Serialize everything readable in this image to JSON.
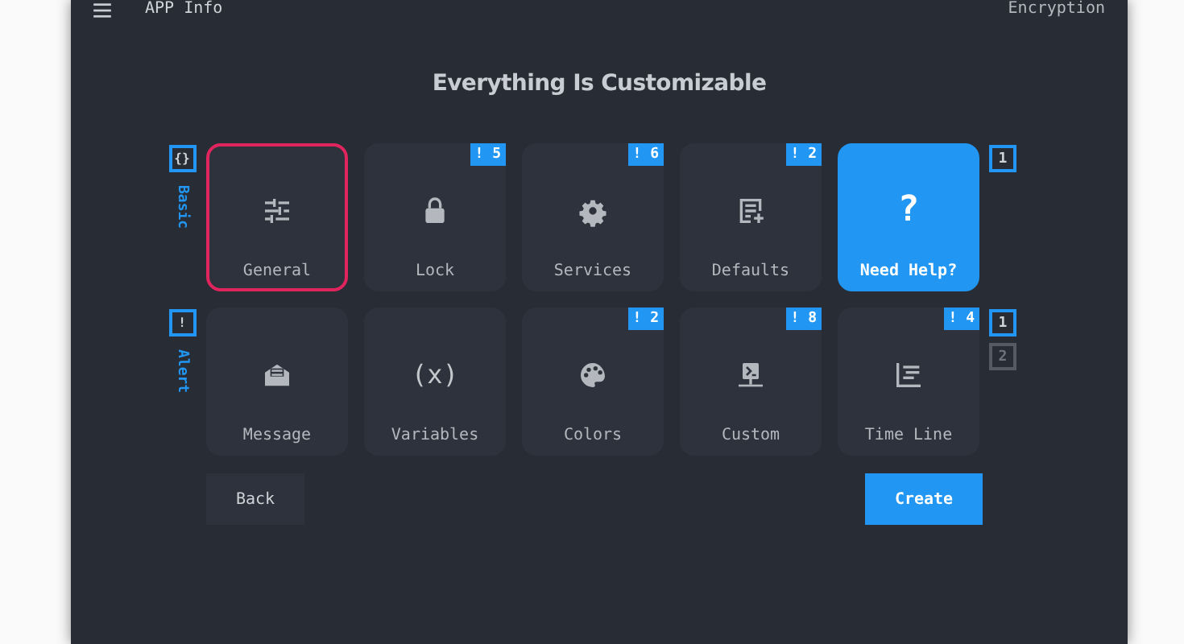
{
  "header": {
    "title": "APP Info",
    "right_label": "Encryption"
  },
  "heading": "Everything Is Customizable",
  "rows": [
    {
      "group": {
        "symbol": "{}",
        "label": "Basic"
      },
      "pager": [
        {
          "label": "1",
          "selected": true
        }
      ],
      "tiles": [
        {
          "label": "General",
          "selected": true,
          "kind": "plain"
        },
        {
          "label": "Lock",
          "selected": false,
          "kind": "plain",
          "badge": "! 5"
        },
        {
          "label": "Services",
          "selected": false,
          "kind": "plain",
          "badge": "! 6"
        },
        {
          "label": "Defaults",
          "selected": false,
          "kind": "plain",
          "badge": "! 2"
        },
        {
          "label": "Need Help?",
          "selected": false,
          "kind": "accent",
          "glyph": "?"
        }
      ]
    },
    {
      "group": {
        "symbol": "!",
        "label": "Alert"
      },
      "pager": [
        {
          "label": "1",
          "selected": true
        },
        {
          "label": "2",
          "selected": false
        }
      ],
      "tiles": [
        {
          "label": "Message",
          "selected": false,
          "kind": "plain"
        },
        {
          "label": "Variables",
          "selected": false,
          "kind": "plain",
          "glyph": "(x)"
        },
        {
          "label": "Colors",
          "selected": false,
          "kind": "plain",
          "badge": "! 2"
        },
        {
          "label": "Custom",
          "selected": false,
          "kind": "plain",
          "badge": "! 8"
        },
        {
          "label": "Time Line",
          "selected": false,
          "kind": "plain",
          "badge": "! 4"
        }
      ]
    }
  ],
  "buttons": [
    {
      "label": "Back",
      "kind": "secondary"
    },
    {
      "label": "Create",
      "kind": "primary"
    }
  ]
}
